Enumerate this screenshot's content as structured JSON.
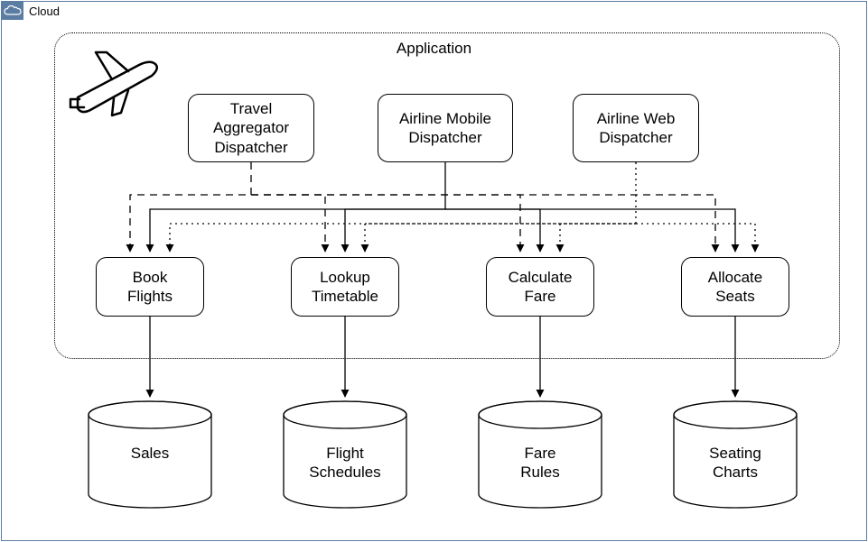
{
  "frame": {
    "label": "Cloud"
  },
  "application": {
    "title": "Application"
  },
  "icons": {
    "cloud": "cloud-icon",
    "airplane": "airplane-icon"
  },
  "dispatchers": {
    "travel": "Travel\nAggregator\nDispatcher",
    "mobile": "Airline Mobile\nDispatcher",
    "web": "Airline Web\nDispatcher"
  },
  "services": {
    "book": "Book\nFlights",
    "lookup": "Lookup\nTimetable",
    "fare": "Calculate\nFare",
    "seats": "Allocate\nSeats"
  },
  "databases": {
    "sales": "Sales",
    "schedules": "Flight\nSchedules",
    "rules": "Fare\nRules",
    "seating": "Seating\nCharts"
  }
}
